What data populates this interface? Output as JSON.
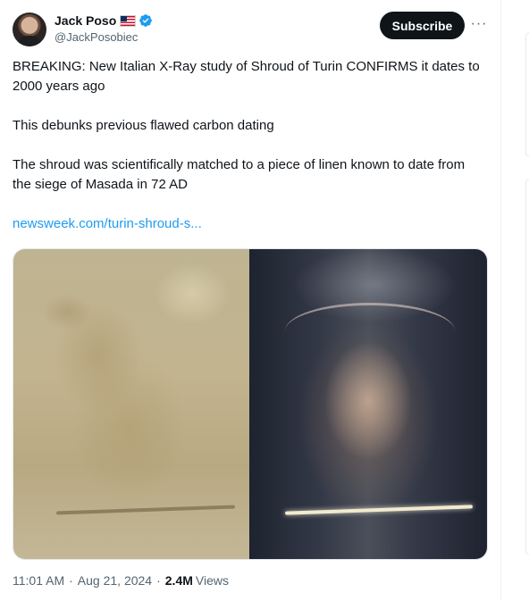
{
  "author": {
    "display_name": "Jack Poso",
    "handle": "@JackPosobiec"
  },
  "actions": {
    "subscribe_label": "Subscribe"
  },
  "tweet": {
    "paragraphs": [
      "BREAKING: New Italian X-Ray study of Shroud of Turin CONFIRMS it dates to 2000 years ago",
      "This debunks previous flawed carbon dating",
      "The shroud was scientifically matched to a piece of linen known to date from the siege of Masada in 72 AD"
    ],
    "link_text": "newsweek.com/turin-shroud-s..."
  },
  "meta": {
    "time": "11:01 AM",
    "date": "Aug 21, 2024",
    "separator": "·",
    "views_count": "2.4M",
    "views_label": "Views"
  },
  "colors": {
    "link": "#1d9bf0",
    "verified": "#1d9bf0",
    "subscribe_bg": "#0f1419"
  }
}
